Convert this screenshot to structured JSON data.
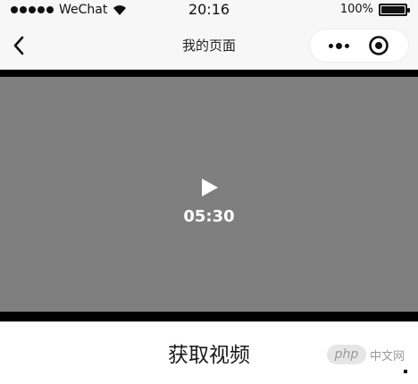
{
  "status_bar": {
    "carrier": "WeChat",
    "time": "20:16",
    "battery_percent_label": "100%",
    "battery_level": 1.0,
    "icons": [
      "signal-dots-icon",
      "wifi-icon",
      "battery-icon"
    ]
  },
  "nav": {
    "title": "我的页面",
    "icons": [
      "back-arrow-icon",
      "more-dots-icon",
      "target-close-icon"
    ]
  },
  "video": {
    "duration": "05:30",
    "icons": [
      "play-icon"
    ]
  },
  "button": {
    "label": "获取视频"
  },
  "watermark": {
    "badge": "php",
    "text": "中文网"
  },
  "colors": {
    "bar_bg": "#f7f7f7",
    "video_bg": "#7f7f7f",
    "video_border": "#000000",
    "text_primary": "#111111"
  }
}
